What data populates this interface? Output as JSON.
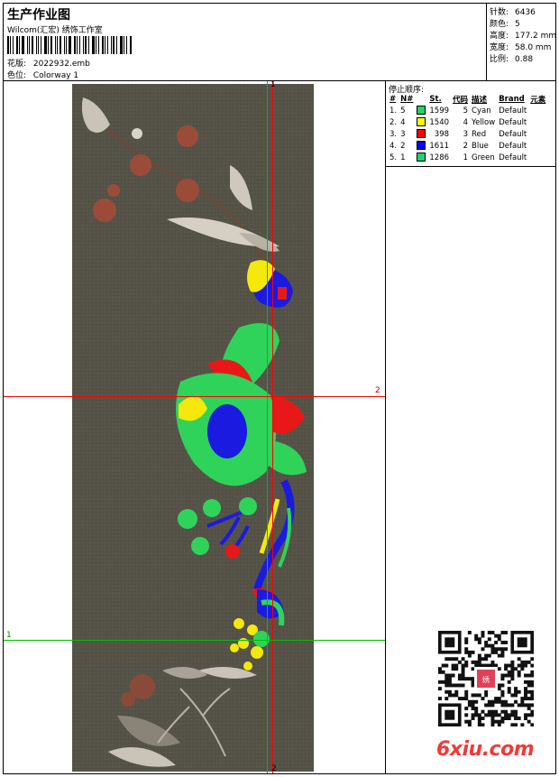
{
  "header": {
    "title": "生产作业图",
    "subtitle": "Wilcom(汇宏) 绣饰工作室",
    "design_label": "花版:",
    "design_value": "2022932.emb",
    "colorway_label": "色位:",
    "colorway_value": "Colorway 1"
  },
  "stats": [
    {
      "label": "针数:",
      "value": "6436"
    },
    {
      "label": "颜色:",
      "value": "5"
    },
    {
      "label": "高度:",
      "value": "177.2 mm"
    },
    {
      "label": "宽度:",
      "value": "58.0 mm"
    },
    {
      "label": "比例:",
      "value": "0.88"
    }
  ],
  "guides": {
    "v_top": "1",
    "v_bottom": "2",
    "h_red": "2",
    "h_green": "1",
    "colors": {
      "red": "#ff0000",
      "green": "#00c000"
    }
  },
  "stop_sequence": {
    "title": "停止顺序:",
    "headers": [
      "#",
      "N#",
      "St.",
      "代码",
      "描述",
      "Brand",
      "元素"
    ],
    "rows": [
      {
        "idx": "1.",
        "n": "5",
        "color": "#22d36b",
        "st": "1599",
        "code": "5",
        "desc": "Cyan",
        "brand": "Default"
      },
      {
        "idx": "2.",
        "n": "4",
        "color": "#ffff00",
        "st": "1540",
        "code": "4",
        "desc": "Yellow",
        "brand": "Default"
      },
      {
        "idx": "3.",
        "n": "3",
        "color": "#ff0000",
        "st": "398",
        "code": "3",
        "desc": "Red",
        "brand": "Default"
      },
      {
        "idx": "4.",
        "n": "2",
        "color": "#0000ff",
        "st": "1611",
        "code": "2",
        "desc": "Blue",
        "brand": "Default"
      },
      {
        "idx": "5.",
        "n": "1",
        "color": "#22d36b",
        "st": "1286",
        "code": "1",
        "desc": "Green",
        "brand": "Default"
      }
    ]
  },
  "watermark": {
    "text": "6xiu.com",
    "seal": "以绣会友"
  },
  "palette": {
    "fabric": "#555347",
    "green": "#2fd35a",
    "blue": "#1a1ae0",
    "yellow": "#f4e80c",
    "red": "#e81818",
    "rust": "#8a4a3a"
  }
}
